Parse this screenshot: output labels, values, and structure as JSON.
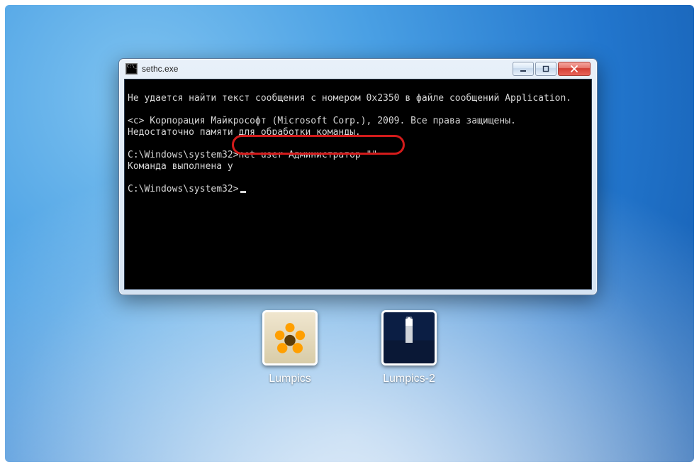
{
  "window": {
    "title": "sethc.exe"
  },
  "terminal": {
    "lines": [
      "Не удается найти текст сообщения с номером 0x2350 в файле сообщений Application.",
      "",
      "<c> Корпорация Майкрософт (Microsoft Corp.), 2009. Все права защищены.",
      "Недостаточно памяти для обработки команды.",
      "",
      "C:\\Windows\\system32>net user Администратор \"\"",
      "Команда выполнена у",
      "",
      "C:\\Windows\\system32>"
    ],
    "highlighted_command": "net user Администратор \"\""
  },
  "accounts": [
    {
      "name": "Lumpics",
      "avatar": "flower"
    },
    {
      "name": "Lumpics-2",
      "avatar": "lighthouse"
    }
  ]
}
